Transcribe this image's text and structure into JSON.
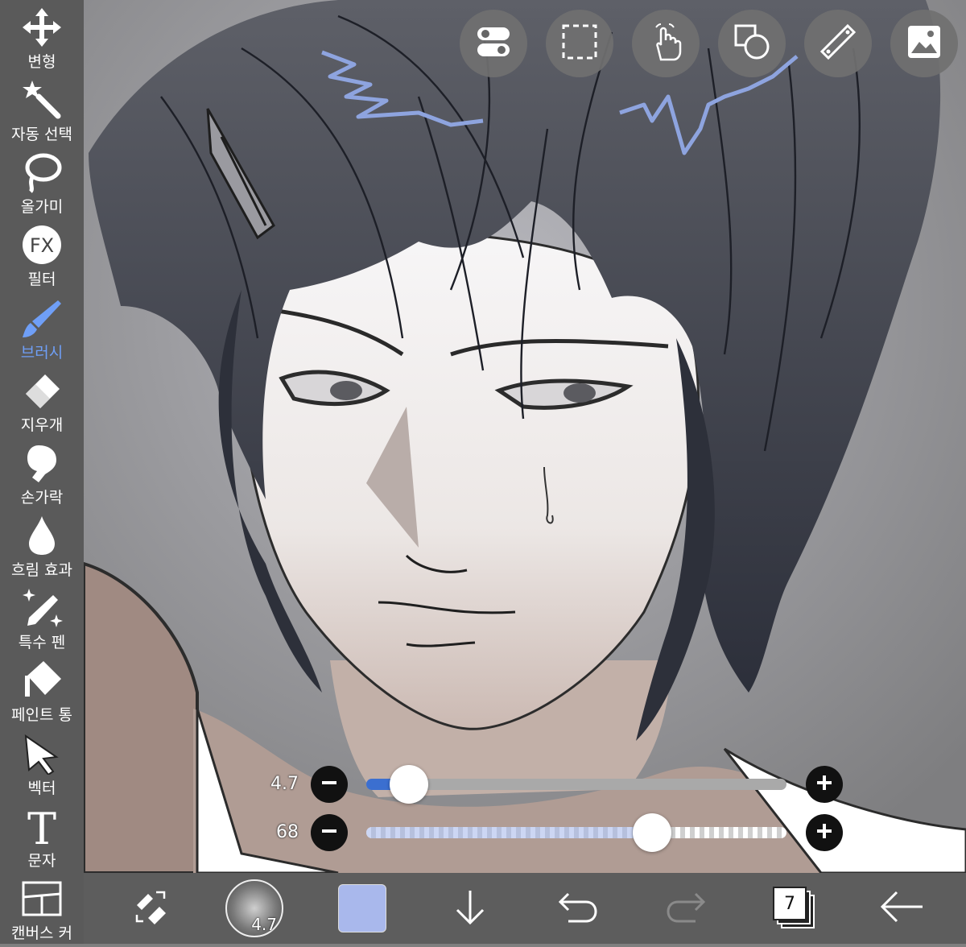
{
  "toolbar": {
    "tools": [
      {
        "label": "변형",
        "icon": "transform-arrows-icon"
      },
      {
        "label": "자동 선택",
        "icon": "magic-wand-icon"
      },
      {
        "label": "올가미",
        "icon": "lasso-icon"
      },
      {
        "label": "필터",
        "icon": "fx-filter-icon"
      },
      {
        "label": "브러시",
        "icon": "brush-icon",
        "active": true
      },
      {
        "label": "지우개",
        "icon": "eraser-icon"
      },
      {
        "label": "손가락",
        "icon": "smudge-finger-icon"
      },
      {
        "label": "흐림 효과",
        "icon": "blur-drop-icon"
      },
      {
        "label": "특수 펜",
        "icon": "special-pen-icon"
      },
      {
        "label": "페인트 통",
        "icon": "paint-bucket-icon"
      },
      {
        "label": "벡터",
        "icon": "vector-cursor-icon"
      },
      {
        "label": "문자",
        "icon": "text-icon"
      },
      {
        "label": "캔버스 커",
        "icon": "frame-icon"
      }
    ],
    "fx_text": "FX",
    "text_tool_glyph": "T",
    "active_color": "#6f9ff7"
  },
  "top_buttons": [
    {
      "name": "toggle-settings-icon"
    },
    {
      "name": "selection-icon"
    },
    {
      "name": "gesture-hand-icon"
    },
    {
      "name": "shape-icon"
    },
    {
      "name": "ruler-icon"
    },
    {
      "name": "reference-image-icon"
    }
  ],
  "sliders": {
    "size": {
      "value_text": "4.7",
      "fraction": 0.07,
      "fill_color": "#3b6fd0"
    },
    "opacity": {
      "value_text": "68",
      "fraction": 0.68,
      "fill_color": "#a3b4ea"
    }
  },
  "bottom_bar": {
    "brush_size_label": "4.7",
    "current_color": "#a9b8ec",
    "layer_count": "7",
    "buttons": [
      "swap-tool-icon",
      "brush-preview",
      "color-swatch",
      "download-arrow-icon",
      "undo-icon",
      "redo-icon",
      "layers-icon",
      "back-arrow-icon"
    ]
  }
}
